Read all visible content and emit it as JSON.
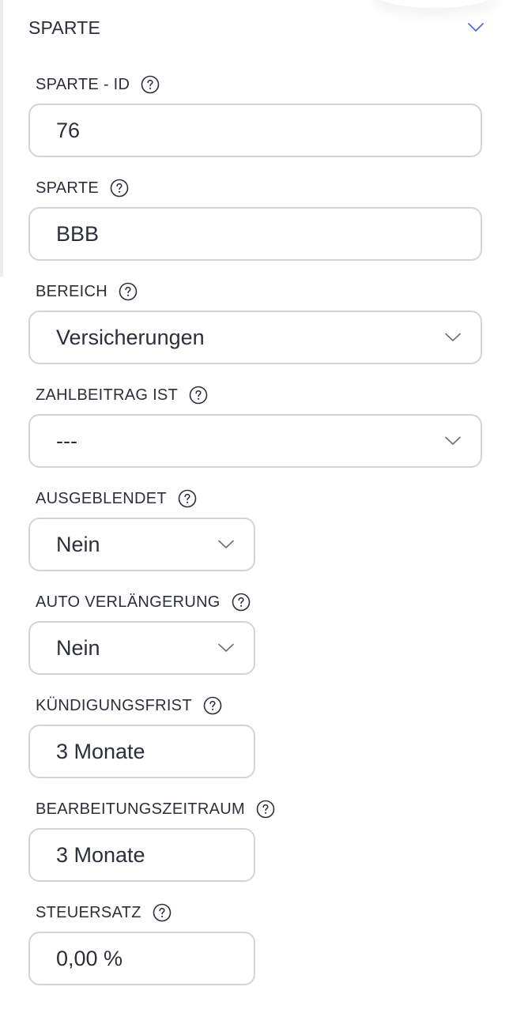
{
  "section": {
    "title": "SPARTE",
    "accent_color": "#4a72d6"
  },
  "fields": [
    {
      "label": "SPARTE - ID",
      "value": "76",
      "type": "text",
      "help_icon": "question-circle-icon"
    },
    {
      "label": "SPARTE",
      "value": "BBB",
      "type": "text",
      "help_icon": "question-circle-icon"
    },
    {
      "label": "BEREICH",
      "value": "Versicherungen",
      "type": "select",
      "help_icon": "question-circle-icon"
    },
    {
      "label": "ZAHLBEITRAG IST",
      "value": "---",
      "type": "select",
      "help_icon": "question-circle-icon"
    },
    {
      "label": "AUSGEBLENDET",
      "value": "Nein",
      "type": "select",
      "help_icon": "question-circle-icon"
    },
    {
      "label": "AUTO VERLÄNGERUNG",
      "value": "Nein",
      "type": "select",
      "help_icon": "question-circle-icon"
    },
    {
      "label": "KÜNDIGUNGSFRIST",
      "value": "3 Monate",
      "type": "text",
      "help_icon": "question-circle-icon"
    },
    {
      "label": "BEARBEITUNGSZEITRAUM",
      "value": "3 Monate",
      "type": "text",
      "help_icon": "question-circle-icon"
    },
    {
      "label": "STEUERSATZ",
      "value": "0,00 %",
      "type": "text",
      "help_icon": "question-circle-icon"
    }
  ]
}
